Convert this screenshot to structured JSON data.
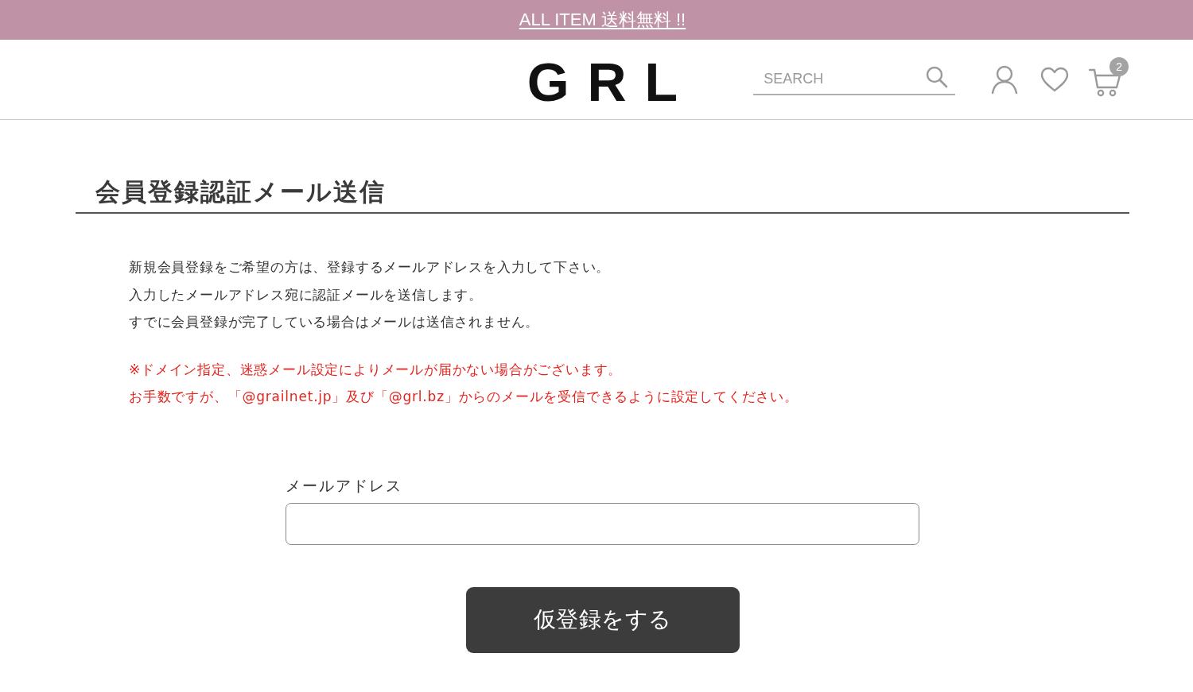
{
  "banner": {
    "text": "ALL ITEM 送料無料 !!"
  },
  "header": {
    "logo": "G R L",
    "search": {
      "placeholder": "SEARCH"
    },
    "cart": {
      "count": "2"
    }
  },
  "page": {
    "title": "会員登録認証メール送信",
    "intro": [
      "新規会員登録をご希望の方は、登録するメールアドレスを入力して下さい。",
      "入力したメールアドレス宛に認証メールを送信します。",
      "すでに会員登録が完了している場合はメールは送信されません。"
    ],
    "notes": [
      "※ドメイン指定、迷惑メール設定によりメールが届かない場合がございます。",
      "お手数ですが、「@grailnet.jp」及び「@grl.bz」からのメールを受信できるように設定してください。"
    ]
  },
  "form": {
    "email": {
      "label": "メールアドレス"
    },
    "submit": "仮登録をする"
  }
}
